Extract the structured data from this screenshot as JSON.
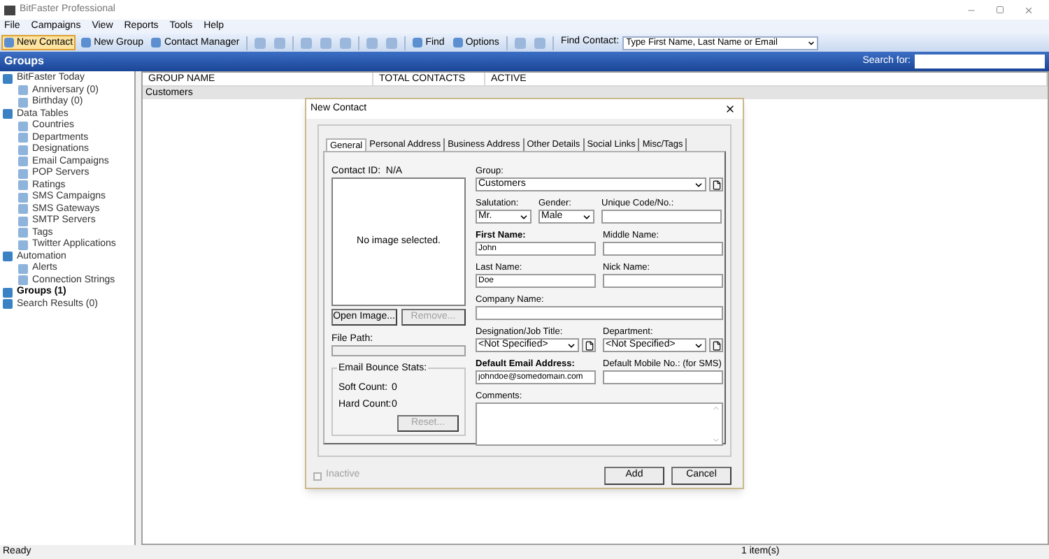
{
  "window": {
    "title": "BitFaster Professional"
  },
  "menu": [
    "File",
    "Campaigns",
    "View",
    "Reports",
    "Tools",
    "Help"
  ],
  "toolbar": [
    {
      "kind": "button",
      "label": "New Contact",
      "highlighted": true
    },
    {
      "kind": "button",
      "label": "New Group",
      "highlighted": false
    },
    {
      "kind": "button",
      "label": "Contact Manager",
      "highlighted": false
    },
    {
      "kind": "separator"
    },
    {
      "kind": "icon"
    },
    {
      "kind": "icon"
    },
    {
      "kind": "separator"
    },
    {
      "kind": "icon"
    },
    {
      "kind": "icon"
    },
    {
      "kind": "icon"
    },
    {
      "kind": "separator"
    },
    {
      "kind": "icon"
    },
    {
      "kind": "icon"
    },
    {
      "kind": "separator"
    },
    {
      "kind": "button",
      "label": "Find",
      "highlighted": false
    },
    {
      "kind": "button",
      "label": "Options",
      "highlighted": false
    },
    {
      "kind": "separator"
    },
    {
      "kind": "icon"
    },
    {
      "kind": "icon"
    },
    {
      "kind": "separator"
    }
  ],
  "find_contact": {
    "label": "Find Contact:",
    "placeholder": "Type First Name, Last Name or Email"
  },
  "header": {
    "title": "Groups",
    "search_label": "Search for:"
  },
  "tree": [
    {
      "label": "BitFaster Today",
      "selected": false,
      "children": [
        {
          "label": "Anniversary (0)",
          "selected": false
        },
        {
          "label": "Birthday (0)",
          "selected": false
        }
      ]
    },
    {
      "label": "Data Tables",
      "selected": false,
      "children": [
        {
          "label": "Countries",
          "selected": false
        },
        {
          "label": "Departments",
          "selected": false
        },
        {
          "label": "Designations",
          "selected": false
        },
        {
          "label": "Email Campaigns",
          "selected": false
        },
        {
          "label": "POP Servers",
          "selected": false
        },
        {
          "label": "Ratings",
          "selected": false
        },
        {
          "label": "SMS Campaigns",
          "selected": false
        },
        {
          "label": "SMS Gateways",
          "selected": false
        },
        {
          "label": "SMTP Servers",
          "selected": false
        },
        {
          "label": "Tags",
          "selected": false
        },
        {
          "label": "Twitter Applications",
          "selected": false
        }
      ]
    },
    {
      "label": "Automation",
      "selected": false,
      "children": [
        {
          "label": "Alerts",
          "selected": false
        },
        {
          "label": "Connection Strings",
          "selected": false
        }
      ]
    },
    {
      "label": "Groups (1)",
      "selected": true
    },
    {
      "label": "Search Results (0)",
      "selected": false
    }
  ],
  "table": {
    "columns": [
      "GROUP NAME",
      "TOTAL CONTACTS",
      "ACTIVE"
    ],
    "rows": [
      {
        "cells": [
          "Customers"
        ],
        "selected": true
      }
    ]
  },
  "dialog": {
    "title": "New Contact",
    "tabs": [
      {
        "label": "General",
        "selected": true
      },
      {
        "label": "Personal Address",
        "selected": false
      },
      {
        "label": "Business Address",
        "selected": false
      },
      {
        "label": "Other Details",
        "selected": false
      },
      {
        "label": "Social Links",
        "selected": false
      },
      {
        "label": "Misc/Tags",
        "selected": false
      }
    ],
    "contact_id": "Contact ID:  N/A",
    "image_placeholder": "No image selected.",
    "image_buttons": [
      {
        "label": "Open Image...",
        "disabled": false
      },
      {
        "label": "Remove...",
        "disabled": true
      }
    ],
    "file_path": {
      "label": "File Path:"
    },
    "bounce": {
      "title": "Email Bounce Stats:",
      "rows": [
        {
          "label": "Soft Count:",
          "value": "0"
        },
        {
          "label": "Hard Count:",
          "value": "0"
        }
      ],
      "reset": {
        "label": "Reset...",
        "disabled": true
      }
    },
    "rows": [
      [
        {
          "kind": "wide_select",
          "label": "Group:",
          "value": "Customers",
          "required": false
        }
      ],
      [
        {
          "kind": "small_select",
          "label": "Salutation:",
          "value": "Mr.",
          "required": false
        },
        {
          "kind": "small_select",
          "label": "Gender:",
          "value": "Male",
          "required": false
        },
        {
          "kind": "text",
          "label": "Unique Code/No.:",
          "required": false
        }
      ],
      [
        {
          "kind": "text",
          "label": "First Name:",
          "value": "John",
          "required": true
        },
        {
          "kind": "text",
          "label": "Middle Name:",
          "required": false
        }
      ],
      [
        {
          "kind": "text",
          "label": "Last Name:",
          "value": "Doe",
          "required": false
        },
        {
          "kind": "text",
          "label": "Nick Name:",
          "required": false
        }
      ],
      [
        {
          "kind": "wide_text",
          "label": "Company Name:",
          "required": false
        }
      ],
      [
        {
          "kind": "select",
          "label": "Designation/Job Title:",
          "value": "<Not Specified>",
          "required": false
        },
        {
          "kind": "select",
          "label": "Department:",
          "value": "<Not Specified>",
          "required": false
        }
      ],
      [
        {
          "kind": "text",
          "label": "Default Email Address:",
          "value": "johndoe@somedomain.com",
          "required": true
        },
        {
          "kind": "text",
          "label": "Default Mobile No.: (for SMS)",
          "required": false
        }
      ],
      [
        {
          "kind": "textarea",
          "label": "Comments:",
          "required": false
        }
      ]
    ],
    "inactive": {
      "label": "Inactive",
      "checked": false,
      "disabled": true
    },
    "buttons": [
      "Add",
      "Cancel"
    ]
  },
  "status_bar": [
    "Ready",
    "1 item(s)"
  ]
}
